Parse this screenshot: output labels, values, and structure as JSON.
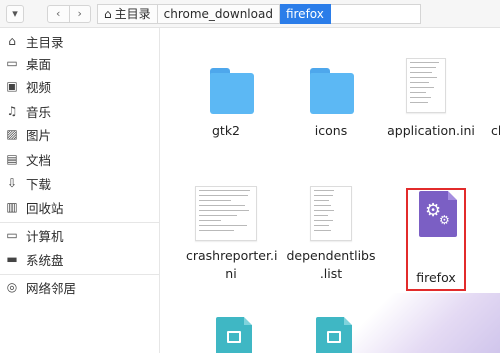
{
  "toolbar": {
    "back_glyph": "‹",
    "forward_glyph": "›",
    "up_glyph": "▾"
  },
  "breadcrumb": [
    {
      "label": "主目录",
      "icon": "home-icon"
    },
    {
      "label": "chrome_download"
    },
    {
      "label": "firefox",
      "active": true
    }
  ],
  "sidebar": {
    "items": [
      {
        "label": "主目录",
        "icon": "home-icon",
        "glyph": "⌂"
      },
      {
        "label": "桌面",
        "icon": "desktop-icon",
        "glyph": "▭"
      },
      {
        "label": "视频",
        "icon": "video-icon",
        "glyph": "▣"
      },
      {
        "label": "音乐",
        "icon": "music-icon",
        "glyph": "♫"
      },
      {
        "label": "图片",
        "icon": "image-icon",
        "glyph": "▨"
      },
      {
        "label": "文档",
        "icon": "document-icon",
        "glyph": "▤"
      },
      {
        "label": "下载",
        "icon": "download-icon",
        "glyph": "⇩"
      },
      {
        "label": "回收站",
        "icon": "trash-icon",
        "glyph": "▥"
      },
      {
        "label": "计算机",
        "icon": "computer-icon",
        "glyph": "▭"
      },
      {
        "label": "系统盘",
        "icon": "disk-icon",
        "glyph": "▬"
      },
      {
        "label": "网络邻居",
        "icon": "network-icon",
        "glyph": "◎"
      }
    ]
  },
  "files": [
    {
      "name": "gtk2",
      "type": "folder",
      "icon": "folder-icon"
    },
    {
      "name": "icons",
      "type": "folder",
      "icon": "folder-icon"
    },
    {
      "name": "application.ini",
      "type": "text",
      "icon": "text-file-icon"
    },
    {
      "name": "ch",
      "type": "text",
      "icon": "text-file-icon"
    },
    {
      "name_line1": "crashreporter.i",
      "name_line2": "ni",
      "type": "text",
      "icon": "text-file-icon"
    },
    {
      "name_line1": "dependentlibs",
      "name_line2": ".list",
      "type": "text",
      "icon": "text-file-icon"
    },
    {
      "name": "firefox",
      "type": "executable",
      "icon": "gear-icon",
      "selected": true
    },
    {
      "name": "",
      "type": "package",
      "icon": "package-icon"
    },
    {
      "name": "",
      "type": "package",
      "icon": "package-icon"
    }
  ],
  "colors": {
    "folder": "#5cb8f4",
    "breadcrumb_active": "#2b7de9",
    "executable": "#7b5fc4",
    "package": "#3fb7c4",
    "highlight_box": "#e22b2b"
  }
}
